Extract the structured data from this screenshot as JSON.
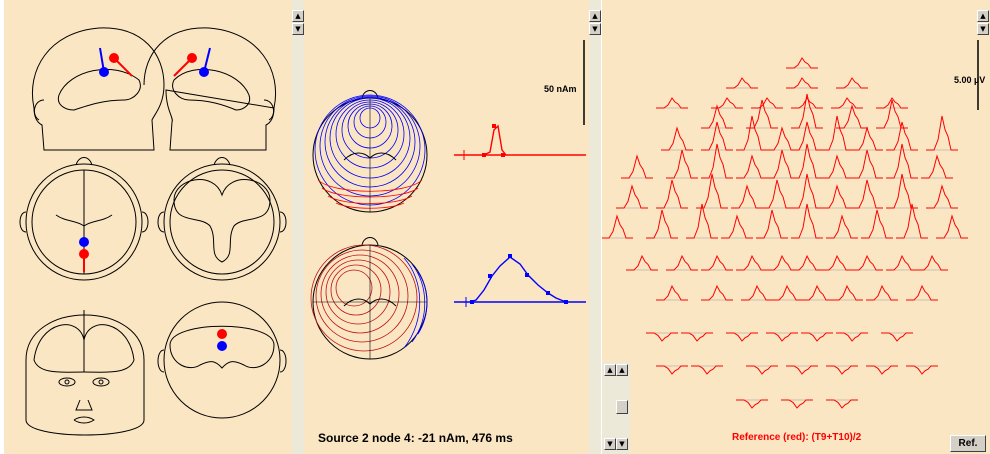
{
  "source_caption": "Source 2 node 4: -21 nAm, 476 ms",
  "reference_caption": "Reference (red): (T9+T10)/2",
  "ref_button_label": "Ref.",
  "moment_scale_label": "50 nAm",
  "eeg_scale_label": "5.00 µV",
  "scroll_up_glyph": "▲",
  "scroll_down_glyph": "▼",
  "colors": {
    "panel_bg": "#fbe6c4",
    "red": "#ff0000",
    "blue": "#0000ff",
    "outline": "#000000"
  }
}
